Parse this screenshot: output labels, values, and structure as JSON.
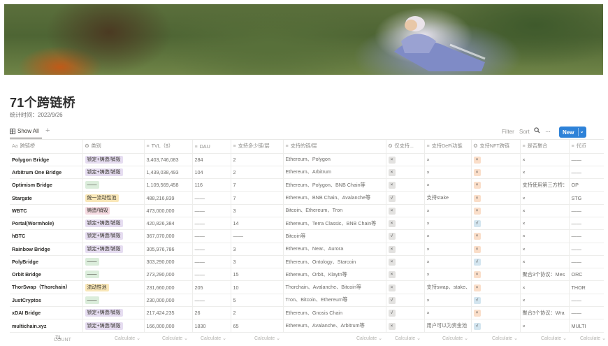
{
  "page": {
    "title": "71个跨链桥",
    "subtitle": "统计时间：2022/9/26"
  },
  "toolbar": {
    "view_label": "Show All",
    "add_view": "+",
    "filter": "Filter",
    "sort": "Sort",
    "search_icon": "search-icon",
    "more": "···",
    "new_label": "New",
    "new_chevron": "⌄"
  },
  "colors": {
    "accent": "#2e82d8",
    "tag_purple": "#e6ddf1",
    "tag_green": "#dbeddb",
    "tag_yellow": "#f9e7b8",
    "tag_pink": "#f6dbe2",
    "check_gray": "#e3e2e0",
    "check_blue": "#d3e5ef",
    "check_orange": "#fadec9"
  },
  "table": {
    "columns": [
      {
        "icon": "Aa",
        "label": "跨链桥"
      },
      {
        "icon": "✪",
        "label": "类别"
      },
      {
        "icon": "≡",
        "label": "TVL（$）"
      },
      {
        "icon": "≡",
        "label": "DAU"
      },
      {
        "icon": "≡",
        "label": "支持多少链/层"
      },
      {
        "icon": "≡",
        "label": "支持的链/层"
      },
      {
        "icon": "✪",
        "label": "仅支持..."
      },
      {
        "icon": "≡",
        "label": "支持DeFi功能"
      },
      {
        "icon": "✪",
        "label": "支持NFT跨链"
      },
      {
        "icon": "≡",
        "label": "是否聚合"
      },
      {
        "icon": "≡",
        "label": "代币"
      }
    ],
    "rows": [
      {
        "name": "Polygon Bridge",
        "category": "锁定+铸造/销毁",
        "cat_color": "purple",
        "tvl": "3,403,746,083",
        "dau": "284",
        "chain_count": "2",
        "chains": "Ethereum、Polygon",
        "only": "×",
        "only_color": "gray",
        "defi": "×",
        "nft": "×",
        "nft_color": "orange",
        "agg": "×",
        "token": "——"
      },
      {
        "name": "Arbitrum One Bridge",
        "category": "锁定+铸造/销毁",
        "cat_color": "purple",
        "tvl": "1,439,038,493",
        "dau": "104",
        "chain_count": "2",
        "chains": "Ethereum、Arbitrum",
        "only": "×",
        "only_color": "gray",
        "defi": "×",
        "nft": "×",
        "nft_color": "orange",
        "agg": "×",
        "token": "——"
      },
      {
        "name": "Optimism Bridge",
        "category": "——",
        "cat_color": "green",
        "tvl": "1,109,569,458",
        "dau": "116",
        "chain_count": "7",
        "chains": "Ethereum、Polygon、BNB Chain等",
        "only": "×",
        "only_color": "gray",
        "defi": "×",
        "nft": "×",
        "nft_color": "orange",
        "agg": "支持使用第三方桥：",
        "token": "OP"
      },
      {
        "name": "Stargate",
        "category": "统一流动性池",
        "cat_color": "yellow",
        "tvl": "488,216,839",
        "dau": "——",
        "chain_count": "7",
        "chains": "Ethereum、BNB Chain、Avalanche等",
        "only": "√",
        "only_color": "gray",
        "defi": "支持stake",
        "nft": "×",
        "nft_color": "orange",
        "agg": "×",
        "token": "STG"
      },
      {
        "name": "WBTC",
        "category": "铸造/销毁",
        "cat_color": "pink",
        "tvl": "473,000,000",
        "dau": "——",
        "chain_count": "3",
        "chains": "Bitcoin、Ethereum、Tron",
        "only": "×",
        "only_color": "gray",
        "defi": "×",
        "nft": "×",
        "nft_color": "orange",
        "agg": "×",
        "token": "——"
      },
      {
        "name": "Portal(Wormhole)",
        "category": "锁定+铸造/销毁",
        "cat_color": "purple",
        "tvl": "420,826,384",
        "dau": "——",
        "chain_count": "14",
        "chains": "Ethereum、Terra Classic、BNB Chain等",
        "only": "×",
        "only_color": "gray",
        "defi": "×",
        "nft": "√",
        "nft_color": "blue",
        "agg": "×",
        "token": "——"
      },
      {
        "name": "hBTC",
        "category": "锁定+铸造/销毁",
        "cat_color": "purple",
        "tvl": "367,070,000",
        "dau": "——",
        "chain_count": "——",
        "chains": "Bitcoin等",
        "only": "√",
        "only_color": "gray",
        "defi": "×",
        "nft": "×",
        "nft_color": "orange",
        "agg": "×",
        "token": "——"
      },
      {
        "name": "Rainbow Bridge",
        "category": "锁定+铸造/销毁",
        "cat_color": "purple",
        "tvl": "305,976,786",
        "dau": "——",
        "chain_count": "3",
        "chains": "Ethereum、Near、Aurora",
        "only": "×",
        "only_color": "gray",
        "defi": "×",
        "nft": "×",
        "nft_color": "orange",
        "agg": "×",
        "token": "——"
      },
      {
        "name": "PolyBridge",
        "category": "——",
        "cat_color": "green",
        "tvl": "303,290,000",
        "dau": "——",
        "chain_count": "3",
        "chains": "Ethereum、Ontology、Starcoin",
        "only": "×",
        "only_color": "gray",
        "defi": "×",
        "nft": "√",
        "nft_color": "blue",
        "agg": "×",
        "token": "——"
      },
      {
        "name": "Orbit Bridge",
        "category": "——",
        "cat_color": "green",
        "tvl": "273,290,000",
        "dau": "——",
        "chain_count": "15",
        "chains": "Ethereum、Orbit、Klaytn等",
        "only": "×",
        "only_color": "gray",
        "defi": "×",
        "nft": "×",
        "nft_color": "orange",
        "agg": "聚合3个协议：Mes",
        "token": "ORC"
      },
      {
        "name": "ThorSwap（Thorchain）",
        "category": "流动性池",
        "cat_color": "yellow",
        "tvl": "231,660,000",
        "dau": "205",
        "chain_count": "10",
        "chains": "Thorchain、Avalanche、Bitcoin等",
        "only": "×",
        "only_color": "gray",
        "defi": "支持swap、stake、",
        "nft": "×",
        "nft_color": "orange",
        "agg": "×",
        "token": "THOR"
      },
      {
        "name": "JustCryptos",
        "category": "——",
        "cat_color": "green",
        "tvl": "230,000,000",
        "dau": "——",
        "chain_count": "5",
        "chains": "Tron、Bitcoin、Ethereum等",
        "only": "√",
        "only_color": "gray",
        "defi": "×",
        "nft": "√",
        "nft_color": "blue",
        "agg": "×",
        "token": "——"
      },
      {
        "name": "xDAI Bridge",
        "category": "锁定+铸造/销毁",
        "cat_color": "purple",
        "tvl": "217,424,235",
        "dau": "26",
        "chain_count": "2",
        "chains": "Ethereum、Gnosis Chain",
        "only": "√",
        "only_color": "gray",
        "defi": "×",
        "nft": "×",
        "nft_color": "orange",
        "agg": "聚合3个协议：Wra",
        "token": "——"
      },
      {
        "name": "multichain.xyz",
        "category": "锁定+铸造/销毁",
        "cat_color": "purple",
        "tvl": "166,000,000",
        "dau": "1830",
        "chain_count": "65",
        "chains": "Ethereum、Avalanche、Arbitrum等",
        "only": "×",
        "only_color": "gray",
        "defi": "用户可以为资金池",
        "nft": "√",
        "nft_color": "blue",
        "agg": "×",
        "token": "MULTI"
      }
    ]
  },
  "footer": {
    "count_label": "COUNT",
    "count_value": "71",
    "calculate": "Calculate ⌄"
  }
}
